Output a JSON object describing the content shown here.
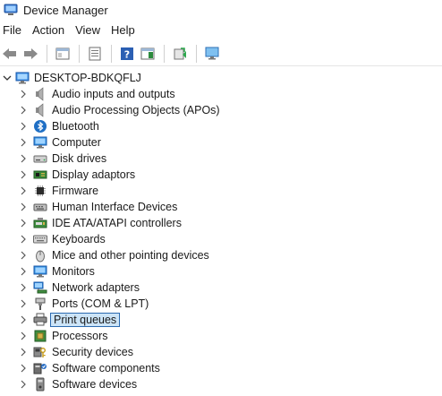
{
  "window": {
    "title": "Device Manager"
  },
  "menu": {
    "file": "File",
    "action": "Action",
    "view": "View",
    "help": "Help"
  },
  "toolbar": {
    "icons": [
      "back-arrow-icon",
      "forward-arrow-icon",
      "show-hide-tree-icon",
      "properties-icon",
      "help-icon",
      "action-pane-icon",
      "update-driver-icon",
      "scan-hardware-icon"
    ]
  },
  "tree": {
    "root": {
      "label": "DESKTOP-BDKQFLJ",
      "icon": "computer-icon"
    },
    "items": [
      {
        "label": "Audio inputs and outputs",
        "icon": "speaker-icon"
      },
      {
        "label": "Audio Processing Objects (APOs)",
        "icon": "speaker-icon"
      },
      {
        "label": "Bluetooth",
        "icon": "bluetooth-icon"
      },
      {
        "label": "Computer",
        "icon": "monitor-icon"
      },
      {
        "label": "Disk drives",
        "icon": "disk-drive-icon"
      },
      {
        "label": "Display adaptors",
        "icon": "display-adapter-icon"
      },
      {
        "label": "Firmware",
        "icon": "chip-icon"
      },
      {
        "label": "Human Interface Devices",
        "icon": "hid-icon"
      },
      {
        "label": "IDE ATA/ATAPI controllers",
        "icon": "ide-controller-icon"
      },
      {
        "label": "Keyboards",
        "icon": "keyboard-icon"
      },
      {
        "label": "Mice and other pointing devices",
        "icon": "mouse-icon"
      },
      {
        "label": "Monitors",
        "icon": "monitor-icon"
      },
      {
        "label": "Network adapters",
        "icon": "network-adapter-icon"
      },
      {
        "label": "Ports (COM & LPT)",
        "icon": "port-icon"
      },
      {
        "label": "Print queues",
        "icon": "printer-icon",
        "selected": true
      },
      {
        "label": "Processors",
        "icon": "processor-icon"
      },
      {
        "label": "Security devices",
        "icon": "security-icon"
      },
      {
        "label": "Software components",
        "icon": "software-component-icon"
      },
      {
        "label": "Software devices",
        "icon": "software-device-icon"
      }
    ]
  },
  "colors": {
    "selection_bg": "#cce4f7",
    "selection_border": "#2d6bb0",
    "accent": "#1f6fc5"
  }
}
